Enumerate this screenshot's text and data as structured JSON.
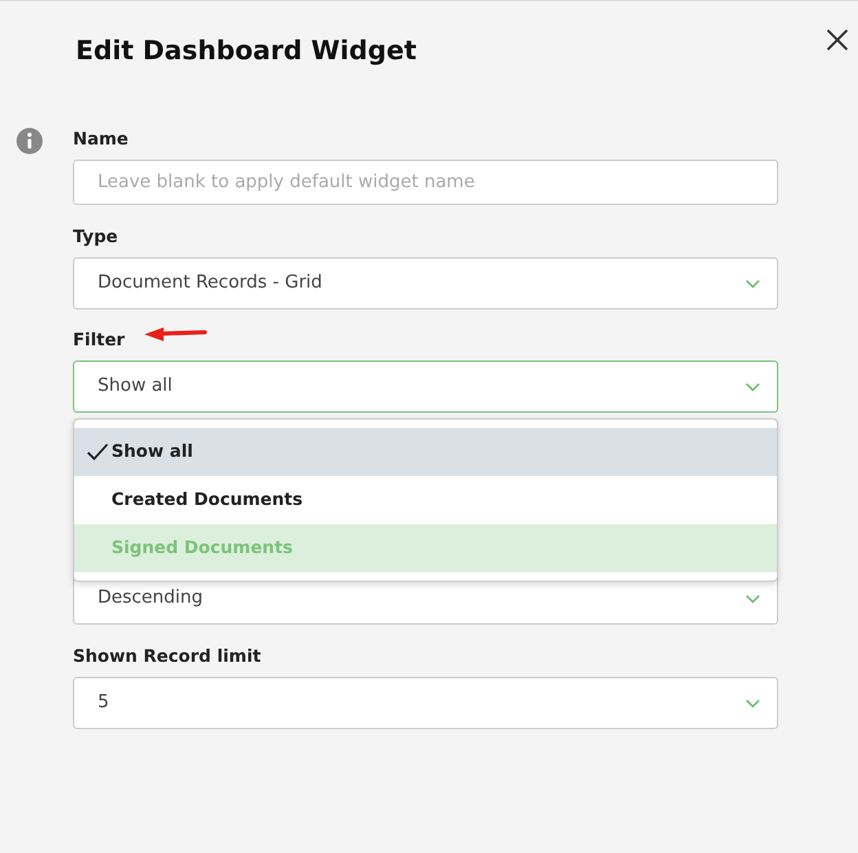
{
  "dialog": {
    "title": "Edit Dashboard Widget"
  },
  "fields": [
    {
      "kind": "text",
      "label": "Name",
      "placeholder": "Leave blank to apply default widget name",
      "info": true
    },
    {
      "kind": "select",
      "label": "Type",
      "value": "Document Records - Grid"
    },
    {
      "kind": "select",
      "label": "Filter",
      "value": "Show all",
      "open": true,
      "annotated": true,
      "options": [
        {
          "label": "Show all",
          "selected": true,
          "highlighted": false
        },
        {
          "label": "Created Documents",
          "selected": false,
          "highlighted": false
        },
        {
          "label": "Signed Documents",
          "selected": false,
          "highlighted": true
        }
      ]
    },
    {
      "kind": "select",
      "value": "Descending",
      "covered": true
    },
    {
      "kind": "select",
      "label": "Shown Record limit",
      "value": "5"
    }
  ]
}
